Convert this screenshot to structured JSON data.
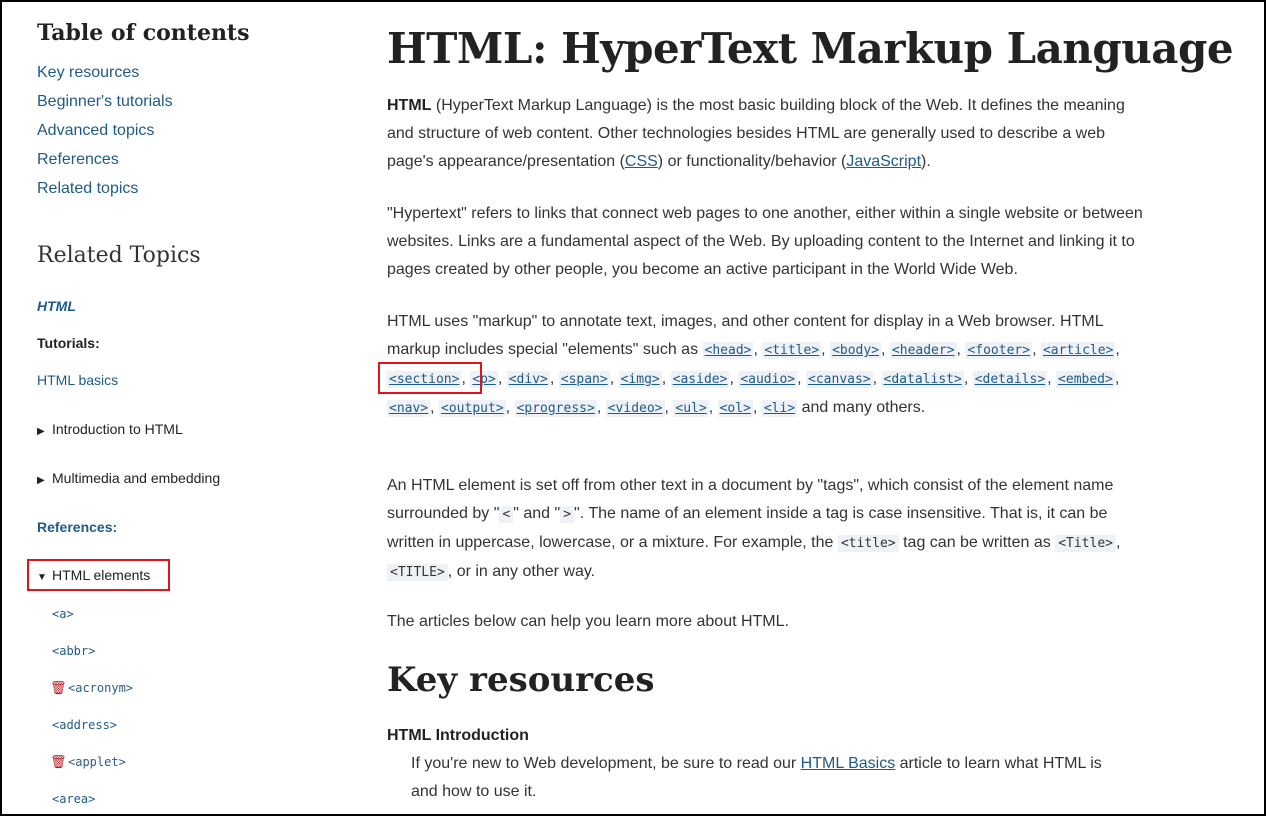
{
  "toc": {
    "title": "Table of contents",
    "items": [
      "Key resources",
      "Beginner's tutorials",
      "Advanced topics",
      "References",
      "Related topics"
    ]
  },
  "related": {
    "title": "Related Topics",
    "html_label": "HTML",
    "tutorials_label": "Tutorials:",
    "html_basics": "HTML basics",
    "intro": "Introduction to HTML",
    "multimedia": "Multimedia and embedding",
    "references_label": "References:",
    "html_elements": "HTML elements",
    "elements": [
      {
        "label": "<a>",
        "deprecated": false
      },
      {
        "label": "<abbr>",
        "deprecated": false
      },
      {
        "label": "<acronym>",
        "deprecated": true
      },
      {
        "label": "<address>",
        "deprecated": false
      },
      {
        "label": "<applet>",
        "deprecated": true
      },
      {
        "label": "<area>",
        "deprecated": false
      }
    ]
  },
  "main": {
    "title": "HTML: HyperText Markup Language",
    "p1": {
      "strong": "HTML",
      "t1": " (HyperText Markup Language) is the most basic building block of the Web. It defines the meaning and structure of web content. Other technologies besides HTML are generally used to describe a web page's appearance/presentation (",
      "css": "CSS",
      "t2": ") or functionality/behavior (",
      "js": "JavaScript",
      "t3": ")."
    },
    "p2": "\"Hypertext\" refers to links that connect web pages to one another, either within a single website or between websites. Links are a fundamental aspect of the Web. By uploading content to the Internet and linking it to pages created by other people, you become an active participant in the World Wide Web.",
    "p3": {
      "intro": "HTML uses \"markup\" to annotate text, images, and other content for display in a Web browser. HTML markup includes special \"elements\" such as ",
      "tags": [
        "<head>",
        "<title>",
        "<body>",
        "<header>",
        "<footer>",
        "<article>",
        "<section>",
        "<p>",
        "<div>",
        "<span>",
        "<img>",
        "<aside>",
        "<audio>",
        "<canvas>",
        "<datalist>",
        "<details>",
        "<embed>",
        "<nav>",
        "<output>",
        "<progress>",
        "<video>",
        "<ul>",
        "<ol>",
        "<li>"
      ],
      "outro": " and many others."
    },
    "p4": {
      "t1": "An HTML element is set off from other text in a document by \"tags\", which consist of the element name surrounded by \"",
      "lt": "<",
      "t2": "\" and \"",
      "gt": ">",
      "t3": "\".  The name of an element inside a tag is case insensitive. That is, it can be written in uppercase, lowercase, or a mixture. For example, the ",
      "c1": "<title>",
      "t4": " tag can be written as ",
      "c2": "<Title>",
      "t5": ", ",
      "c3": "<TITLE>",
      "t6": ", or in any other way."
    },
    "p5": "The articles below can help you learn more about HTML.",
    "h2": "Key resources",
    "h3": "HTML Introduction",
    "dd": {
      "t1": "If you're new to Web development, be sure to read our ",
      "link": "HTML Basics",
      "t2": " article to learn what HTML is and how to use it."
    }
  }
}
